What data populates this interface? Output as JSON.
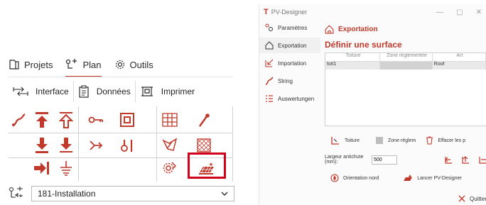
{
  "left_panel": {
    "tabs": [
      {
        "label": "Projets",
        "icon": "project-icon"
      },
      {
        "label": "Plan",
        "icon": "plan-icon",
        "active": true
      },
      {
        "label": "Outils",
        "icon": "gear-icon"
      }
    ],
    "toolbar": [
      {
        "label": "Interface",
        "icon": "interface-icon"
      },
      {
        "label": "Données",
        "icon": "clipboard-icon"
      },
      {
        "label": "Imprimer",
        "icon": "print-icon"
      }
    ],
    "dropdown": {
      "value": "181-Installation",
      "icon": "installation-icon"
    }
  },
  "window": {
    "title": "PV-Designer",
    "app_logo": "T",
    "sidebar": [
      {
        "label": "Paramètres",
        "icon": "settings-icon"
      },
      {
        "label": "Exportation",
        "icon": "home-icon",
        "active": true
      },
      {
        "label": "Importation",
        "icon": "import-icon"
      },
      {
        "label": "String",
        "icon": "string-icon"
      },
      {
        "label": "Auswertungen",
        "icon": "list-icon"
      }
    ],
    "header": "Exportation",
    "section_title": "Définir une surface",
    "table": {
      "columns": [
        "Toiture",
        "Zone réglementée",
        "Art"
      ],
      "rows": [
        [
          "toit1",
          "",
          "Roof"
        ]
      ]
    },
    "actions": [
      {
        "label": "Toiture",
        "icon": "roof-icon"
      },
      {
        "label": "Zone réglem",
        "icon": "zone-icon"
      },
      {
        "label": "Effacer les p",
        "icon": "trash-icon"
      }
    ],
    "gutter": {
      "label": "Largeur antichute (mm):",
      "value": "500"
    },
    "buttons": [
      {
        "label": "Orientation nord",
        "icon": "compass-icon"
      },
      {
        "label": "Lancer PV-Designer",
        "icon": "pv-designer-icon"
      }
    ],
    "quit_label": "Quitter",
    "accent": "#c0392b"
  }
}
